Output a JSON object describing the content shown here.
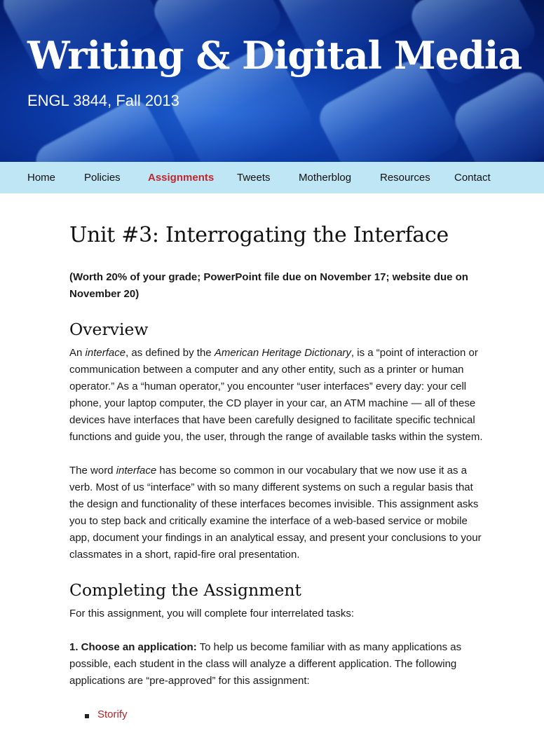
{
  "header": {
    "title": "Writing & Digital Media",
    "subtitle": "ENGL 3844, Fall 2013"
  },
  "nav": {
    "items": [
      {
        "label": "Home"
      },
      {
        "label": "Policies"
      },
      {
        "label": "Assignments",
        "active": true
      },
      {
        "label": "Tweets"
      },
      {
        "label": "Motherblog"
      },
      {
        "label": "Resources"
      },
      {
        "label": "Contact"
      }
    ]
  },
  "article": {
    "title": "Unit #3: Interrogating the Interface",
    "lead": "(Worth 20% of your grade; PowerPoint file due on November 17; website due on November 20)",
    "overview": {
      "heading": "Overview",
      "p1": {
        "t1": "An ",
        "em1": "interface",
        "t2": ", as defined by the ",
        "em2": "American Heritage Dictionary",
        "t3": ", is a “point of interaction or communication between a computer and any other entity, such as a printer or human operator.” As a “human operator,” you encounter “user interfaces” every day: your cell phone, your laptop computer, the CD player in your car, an ATM machine — all of these devices have interfaces that have been carefully designed to facilitate specific technical functions and guide you, the user, through the range of available tasks within the system."
      },
      "p2": {
        "t1": "The word ",
        "em1": "interface",
        "t2": " has become so common in our vocabulary that we now use it as a verb. Most of us “interface” with so many different systems on such a regular basis that the design and functionality of these interfaces becomes invisible. This assignment asks you to step back and critically examine the interface of a web-based service or mobile app, document your findings in an analytical essay, and present your conclusions to your classmates in a short, rapid-fire oral presentation."
      }
    },
    "completing": {
      "heading": "Completing the Assignment",
      "intro": "For this assignment, you will complete four interrelated tasks:",
      "step1": {
        "label": "1. Choose an application:",
        "text": " To help us become familiar with as many applications as possible, each student in the class will analyze a different application. The following applications are “pre-approved” for this assignment:"
      },
      "apps": [
        "Storify"
      ]
    }
  },
  "colors": {
    "nav_bg": "#bfe6f5",
    "nav_active": "#c0272d",
    "link": "#b0262b",
    "header_blue": "#0b3aa6"
  }
}
